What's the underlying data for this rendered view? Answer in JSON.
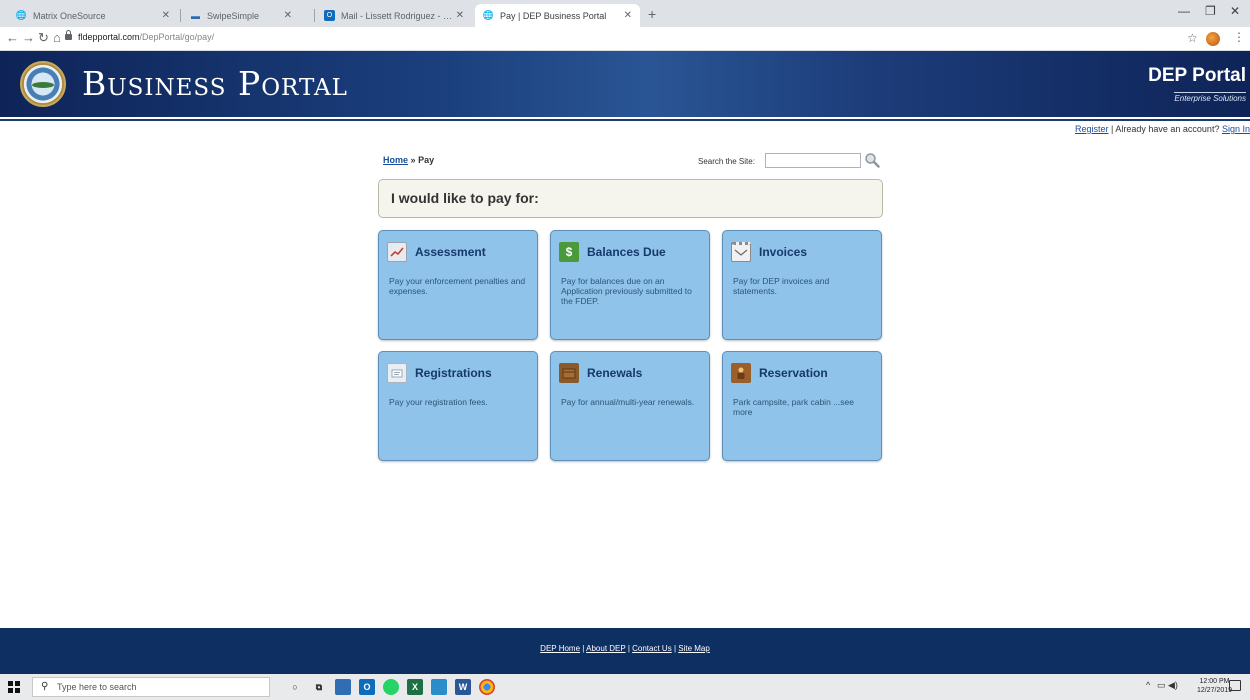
{
  "browser": {
    "tabs": [
      {
        "title": "Matrix OneSource",
        "icon": "globe-icon"
      },
      {
        "title": "SwipeSimple",
        "icon": "swipesimple-icon"
      },
      {
        "title": "Mail - Lissett Rodriguez - Outlo",
        "icon": "outlook-icon"
      },
      {
        "title": "Pay | DEP Business Portal",
        "icon": "globe-icon",
        "active": true
      }
    ],
    "new_tab": "+",
    "url_host": "fldepportal.com",
    "url_path": "/DepPortal/go/pay/"
  },
  "header": {
    "site_title": "Business Portal",
    "brand_name": "DEP Portal",
    "brand_tagline": "Enterprise Solutions"
  },
  "account": {
    "register": "Register",
    "prompt": "Already have an account?",
    "sign_in": "Sign In"
  },
  "breadcrumb": {
    "home": "Home",
    "separator": "»",
    "current": "Pay"
  },
  "search": {
    "label": "Search the Site:",
    "placeholder": ""
  },
  "heading": "I would like to pay for:",
  "cards": [
    {
      "title": "Assessment",
      "description": "Pay your enforcement penalties and expenses.",
      "icon": "assessment-icon"
    },
    {
      "title": "Balances Due",
      "description": "Pay for balances due on an Application previously submitted to the FDEP.",
      "icon": "dollar-icon"
    },
    {
      "title": "Invoices",
      "description": "Pay for DEP invoices and statements.",
      "icon": "invoice-icon"
    },
    {
      "title": "Registrations",
      "description": "Pay your registration fees.",
      "icon": "registration-icon"
    },
    {
      "title": "Renewals",
      "description": "Pay for annual/multi-year renewals.",
      "icon": "renewal-icon"
    },
    {
      "title": "Reservation",
      "description": "Park campsite, park cabin ...see more",
      "icon": "reservation-icon"
    }
  ],
  "footer": {
    "links": [
      "DEP Home",
      "About DEP",
      "Contact Us",
      "Site Map"
    ]
  },
  "taskbar": {
    "search_placeholder": "Type here to search",
    "time": "12:00 PM",
    "date": "12/27/2019",
    "apps": [
      {
        "name": "cortana-icon",
        "color": "#ffffff"
      },
      {
        "name": "task-view-icon",
        "color": "#ffffff"
      },
      {
        "name": "people-icon",
        "color": "#2f6db5"
      },
      {
        "name": "outlook-icon",
        "color": "#0f6cbd"
      },
      {
        "name": "whatsapp-icon",
        "color": "#25d366"
      },
      {
        "name": "excel-icon",
        "color": "#1d7044"
      },
      {
        "name": "store-icon",
        "color": "#2a8cc8"
      },
      {
        "name": "word-icon",
        "color": "#2b579a"
      },
      {
        "name": "chrome-icon",
        "color": "#db4437"
      }
    ]
  }
}
